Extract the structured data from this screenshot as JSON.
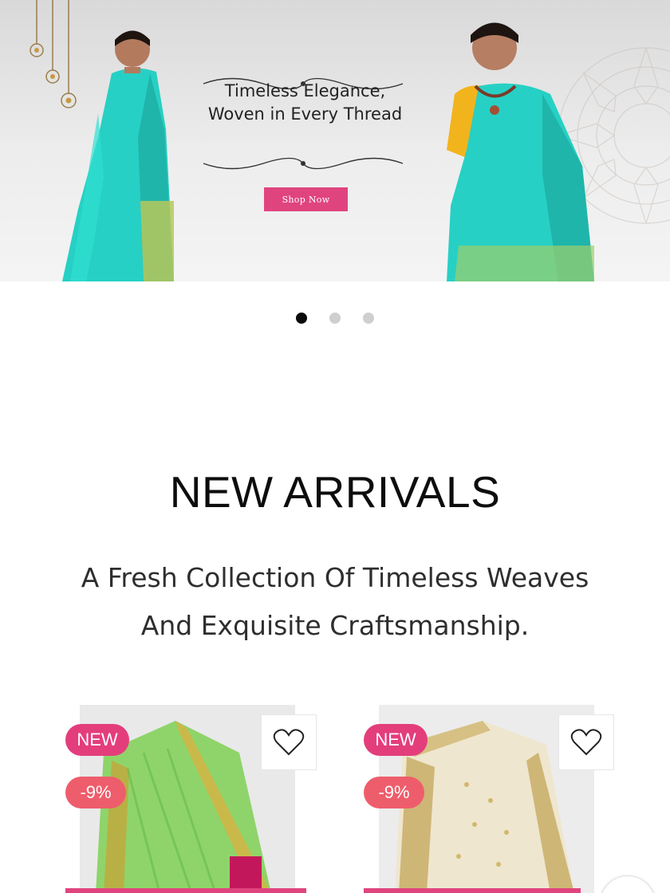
{
  "hero": {
    "title_line1": "Timeless Elegance,",
    "title_line2": "Woven in Every Thread",
    "cta_label": "Shop Now",
    "colors": {
      "cta": "#e0447f",
      "saree": "#2ad6c6",
      "blouse": "#f2b41c"
    }
  },
  "carousel": {
    "slide_count": 3,
    "active_index": 0
  },
  "section": {
    "title": "NEW ARRIVALS",
    "subtitle_line1": "A Fresh Collection Of Timeless Weaves",
    "subtitle_line2": "And Exquisite Craftsmanship."
  },
  "products": [
    {
      "new_badge": "NEW",
      "discount_badge": "-9%",
      "wishlist_icon": "heart-icon",
      "color": "#8fd46a"
    },
    {
      "new_badge": "NEW",
      "discount_badge": "-9%",
      "wishlist_icon": "heart-icon",
      "color": "#e8dcc0"
    }
  ],
  "icons": {
    "wishlist": "heart-icon",
    "scroll": "scroll-top-icon"
  }
}
